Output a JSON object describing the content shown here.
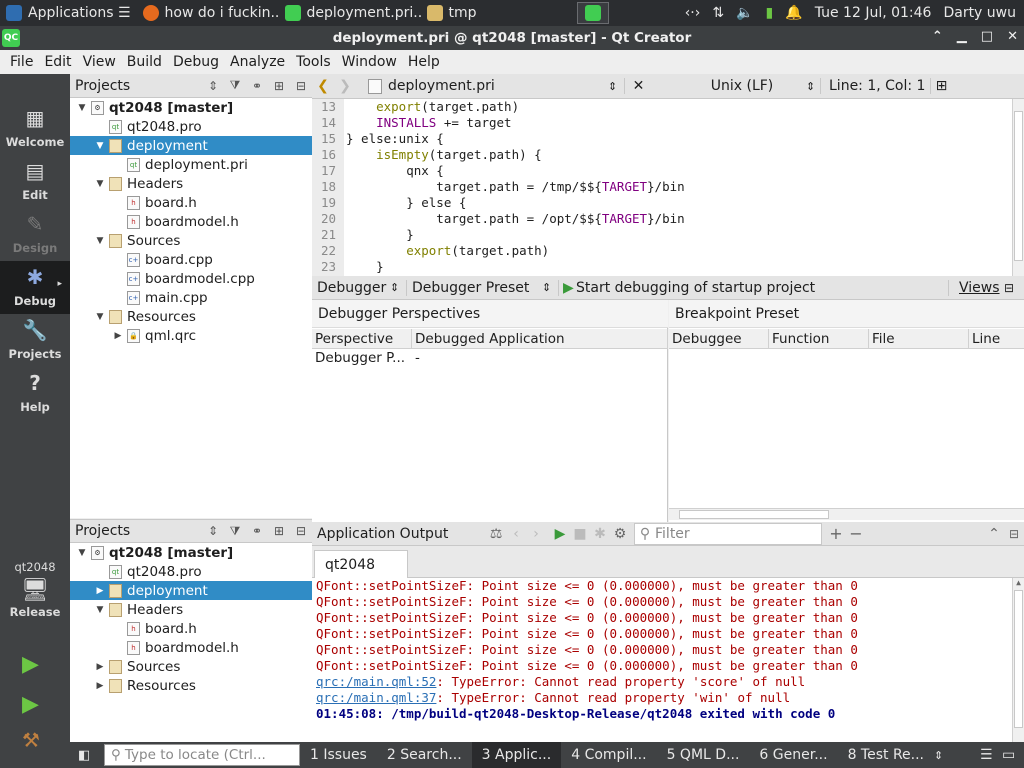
{
  "taskbar": {
    "items": [
      {
        "label": "Applications ☰",
        "icon": "xfce-icon"
      },
      {
        "label": "how do i fuckin...",
        "icon": "firefox-icon"
      },
      {
        "label": "deployment.pri...",
        "icon": "qt-icon"
      },
      {
        "label": "tmp",
        "icon": "folder-icon"
      }
    ],
    "clock": "Tue 12 Jul, 01:46",
    "user": "Darty uwu"
  },
  "window": {
    "title": "deployment.pri @ qt2048 [master] - Qt Creator",
    "app_icon_text": "QC"
  },
  "menu": [
    "File",
    "Edit",
    "View",
    "Build",
    "Debug",
    "Analyze",
    "Tools",
    "Window",
    "Help"
  ],
  "modes": [
    {
      "label": "Welcome",
      "icon": "grid-icon",
      "active": false
    },
    {
      "label": "Edit",
      "icon": "edit-icon",
      "active": false
    },
    {
      "label": "Design",
      "icon": "design-icon",
      "active": false
    },
    {
      "label": "Debug",
      "icon": "bug-icon",
      "active": true
    },
    {
      "label": "Projects",
      "icon": "wrench-icon",
      "active": false
    },
    {
      "label": "Help",
      "icon": "help-icon",
      "active": false
    }
  ],
  "kit": {
    "project": "qt2048",
    "config": "Release"
  },
  "projects_top": {
    "title": "Projects",
    "rows": [
      {
        "label": "qt2048 [master]",
        "depth": 0,
        "expanded": true,
        "type": "project",
        "bold": true
      },
      {
        "label": "qt2048.pro",
        "depth": 1,
        "type": "pro"
      },
      {
        "label": "deployment",
        "depth": 1,
        "expanded": true,
        "type": "folder",
        "selected": true
      },
      {
        "label": "deployment.pri",
        "depth": 2,
        "type": "pro"
      },
      {
        "label": "Headers",
        "depth": 1,
        "expanded": true,
        "type": "folder"
      },
      {
        "label": "board.h",
        "depth": 2,
        "type": "h"
      },
      {
        "label": "boardmodel.h",
        "depth": 2,
        "type": "h"
      },
      {
        "label": "Sources",
        "depth": 1,
        "expanded": true,
        "type": "folder"
      },
      {
        "label": "board.cpp",
        "depth": 2,
        "type": "cpp"
      },
      {
        "label": "boardmodel.cpp",
        "depth": 2,
        "type": "cpp"
      },
      {
        "label": "main.cpp",
        "depth": 2,
        "type": "cpp"
      },
      {
        "label": "Resources",
        "depth": 1,
        "expanded": true,
        "type": "folder"
      },
      {
        "label": "qml.qrc",
        "depth": 2,
        "expanded": false,
        "type": "qrc"
      }
    ]
  },
  "projects_bottom": {
    "title": "Projects",
    "rows": [
      {
        "label": "qt2048 [master]",
        "depth": 0,
        "expanded": true,
        "type": "project",
        "bold": true
      },
      {
        "label": "qt2048.pro",
        "depth": 1,
        "type": "pro"
      },
      {
        "label": "deployment",
        "depth": 1,
        "expanded": false,
        "type": "folder",
        "selected": true
      },
      {
        "label": "Headers",
        "depth": 1,
        "expanded": true,
        "type": "folder"
      },
      {
        "label": "board.h",
        "depth": 2,
        "type": "h"
      },
      {
        "label": "boardmodel.h",
        "depth": 2,
        "type": "h"
      },
      {
        "label": "Sources",
        "depth": 1,
        "expanded": false,
        "type": "folder"
      },
      {
        "label": "Resources",
        "depth": 1,
        "expanded": false,
        "type": "folder"
      }
    ]
  },
  "editor": {
    "file": "deployment.pri",
    "line_endings": "Unix (LF)",
    "position": "Line: 1, Col: 1",
    "lines": [
      {
        "n": "13",
        "text": "    export(target.path)"
      },
      {
        "n": "14",
        "text": "    INSTALLS += target"
      },
      {
        "n": "15",
        "text": "} else:unix {"
      },
      {
        "n": "16",
        "text": "    isEmpty(target.path) {"
      },
      {
        "n": "17",
        "text": "        qnx {"
      },
      {
        "n": "18",
        "text": "            target.path = /tmp/$${TARGET}/bin"
      },
      {
        "n": "19",
        "text": "        } else {"
      },
      {
        "n": "20",
        "text": "            target.path = /opt/$${TARGET}/bin"
      },
      {
        "n": "21",
        "text": "        }"
      },
      {
        "n": "22",
        "text": "        export(target.path)"
      },
      {
        "n": "23",
        "text": "    }"
      }
    ]
  },
  "debugger": {
    "combo1": "Debugger",
    "combo2": "Debugger Preset",
    "start_label": "Start debugging of startup project",
    "views_label": "Views",
    "perspectives_title": "Debugger Perspectives",
    "perspective_cols": [
      "Perspective",
      "Debugged Application"
    ],
    "perspective_row": [
      "Debugger P...",
      "-"
    ],
    "breakpoint_title": "Breakpoint Preset",
    "breakpoint_cols": [
      "Debuggee",
      "Function",
      "File",
      "Line"
    ]
  },
  "output": {
    "title": "Application Output",
    "filter_placeholder": "Filter",
    "tab": "qt2048",
    "warn_line": "QFont::setPointSizeF: Point size <= 0 (0.000000), must be greater than 0",
    "warn_count": 6,
    "link1": "qrc:/main.qml:52",
    "msg1": ": TypeError: Cannot read property 'score' of null",
    "link2": "qrc:/main.qml:37",
    "msg2": ": TypeError: Cannot read property 'win' of null",
    "exit_line": "01:45:08: /tmp/build-qt2048-Desktop-Release/qt2048 exited with code 0"
  },
  "statusbar": {
    "locator_placeholder": "Type to locate (Ctrl...",
    "tabs": [
      "1  Issues",
      "2  Search...",
      "3  Applic...",
      "4  Compil...",
      "5  QML D...",
      "6  Gener...",
      "8  Test Re..."
    ]
  }
}
